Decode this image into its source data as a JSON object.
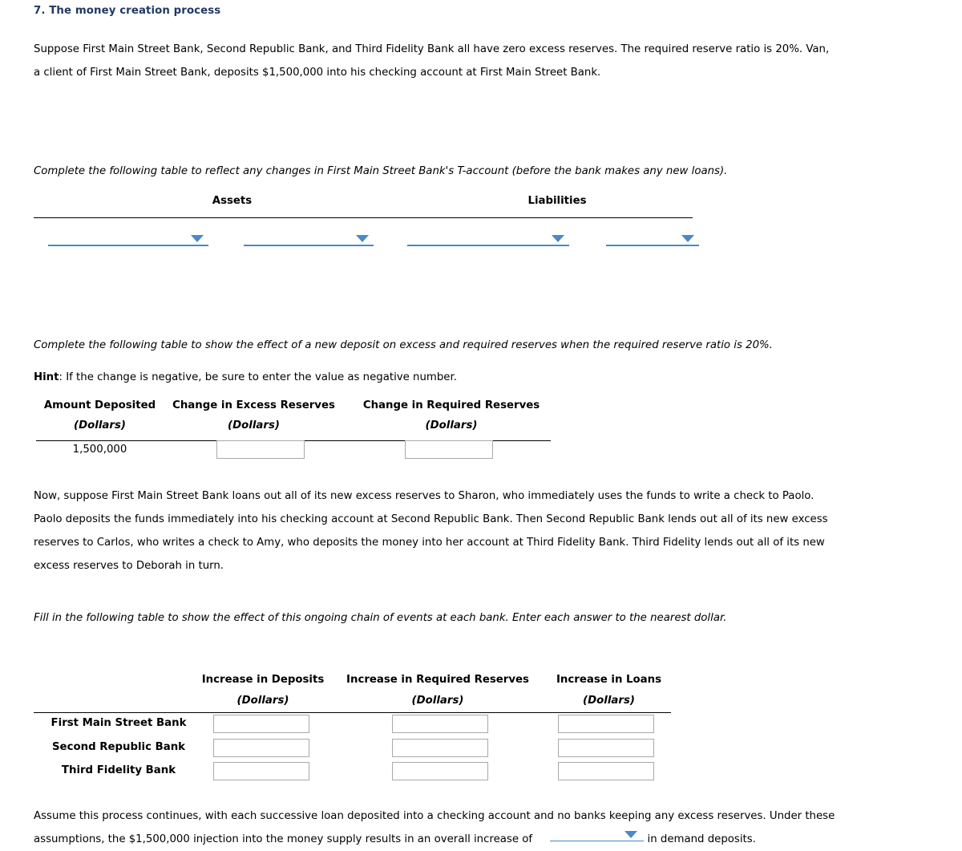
{
  "question": {
    "number_title": "7. The money creation process"
  },
  "intro": {
    "line1": "Suppose First Main Street Bank, Second Republic Bank, and Third Fidelity Bank all have zero excess reserves. The required reserve ratio is 20%. Van,",
    "line2": "a client of First Main Street Bank, deposits $1,500,000 into his checking account at First Main Street Bank."
  },
  "taccount_instruction": "Complete the following table to reflect any changes in First Main Street Bank's T-account (before the bank makes any new loans).",
  "taccount": {
    "assets_header": "Assets",
    "liabilities_header": "Liabilities",
    "dropdowns": [
      {
        "name": "assets-item-dropdown",
        "value": ""
      },
      {
        "name": "assets-amount-dropdown",
        "value": ""
      },
      {
        "name": "liabilities-item-dropdown",
        "value": ""
      },
      {
        "name": "liabilities-amount-dropdown",
        "value": ""
      }
    ]
  },
  "reserves_instruction": "Complete the following table to show the effect of a new deposit on excess and required reserves when the required reserve ratio is 20%.",
  "hint": {
    "label": "Hint",
    "text": ": If the change is negative, be sure to enter the value as negative number."
  },
  "reserves_table": {
    "headers": [
      "Amount Deposited",
      "Change in Excess Reserves",
      "Change in Required Reserves"
    ],
    "units": [
      "(Dollars)",
      "(Dollars)",
      "(Dollars)"
    ],
    "row": {
      "amount_deposited": "1,500,000",
      "change_excess_reserves": "",
      "change_required_reserves": ""
    }
  },
  "chain_paragraph": {
    "line1": "Now, suppose First Main Street Bank loans out all of its new excess reserves to Sharon, who immediately uses the funds to write a check to Paolo.",
    "line2": "Paolo deposits the funds immediately into his checking account at Second Republic Bank. Then Second Republic Bank lends out all of its new excess",
    "line3": "reserves to Carlos, who writes a check to Amy, who deposits the money into her account at Third Fidelity Bank. Third Fidelity lends out all of its new",
    "line4": "excess reserves to Deborah in turn."
  },
  "banks_instruction": "Fill in the following table to show the effect of this ongoing chain of events at each bank. Enter each answer to the nearest dollar.",
  "banks_table": {
    "headers": [
      "Increase in Deposits",
      "Increase in Required Reserves",
      "Increase in Loans"
    ],
    "units": [
      "(Dollars)",
      "(Dollars)",
      "(Dollars)"
    ],
    "rows": [
      {
        "bank": "First Main Street Bank",
        "deposits": "",
        "required_reserves": "",
        "loans": ""
      },
      {
        "bank": "Second Republic Bank",
        "deposits": "",
        "required_reserves": "",
        "loans": ""
      },
      {
        "bank": "Third Fidelity Bank",
        "deposits": "",
        "required_reserves": "",
        "loans": ""
      }
    ]
  },
  "closing": {
    "line1": "Assume this process continues, with each successive loan deposited into a checking account and no banks keeping any excess reserves. Under these",
    "line2_before": "assumptions, the $1,500,000 injection into the money supply results in an overall increase of",
    "dropdown_value": "",
    "line2_after": "in demand deposits."
  },
  "colors": {
    "heading": "#1f3864",
    "accent": "#4a89c8",
    "input_border": "#a9a9a9"
  }
}
